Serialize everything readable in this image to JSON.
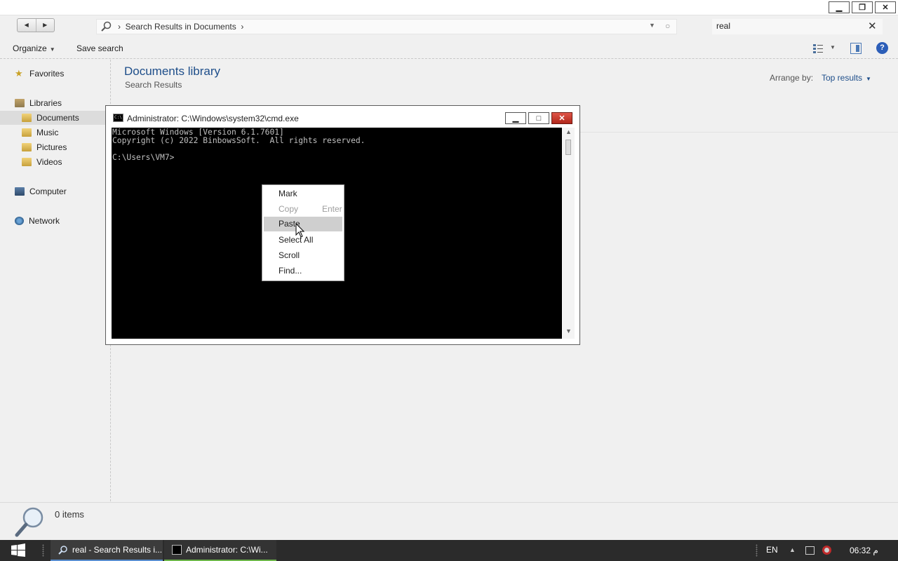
{
  "explorer": {
    "address_path": "Search Results in Documents",
    "address_separator": "›",
    "search_value": "real",
    "organize_label": "Organize",
    "save_search_label": "Save search",
    "library_title": "Documents library",
    "library_subtitle": "Search Results",
    "arrange_label": "Arrange by:",
    "arrange_value": "Top results",
    "status_text": "0 items",
    "nav": {
      "favorites": "Favorites",
      "libraries": "Libraries",
      "documents": "Documents",
      "music": "Music",
      "pictures": "Pictures",
      "videos": "Videos",
      "computer": "Computer",
      "network": "Network"
    }
  },
  "cmd": {
    "title": "Administrator: C:\\Windows\\system32\\cmd.exe",
    "lines": [
      "Microsoft Windows [Version 6.1.7601]",
      "Copyright (c) 2022 BinbowsSoft.  All rights reserved.",
      "",
      "C:\\Users\\VM7>"
    ]
  },
  "context_menu": {
    "items": [
      {
        "label": "Mark",
        "enabled": true,
        "highlighted": false
      },
      {
        "label": "Copy",
        "shortcut": "Enter",
        "enabled": false,
        "highlighted": false
      },
      {
        "label": "Paste",
        "enabled": true,
        "highlighted": true
      },
      {
        "label": "Select All",
        "enabled": true,
        "highlighted": false
      },
      {
        "label": "Scroll",
        "enabled": true,
        "highlighted": false
      },
      {
        "label": "Find...",
        "enabled": true,
        "highlighted": false
      }
    ]
  },
  "taskbar": {
    "explorer_task": "real - Search Results i...",
    "cmd_task": "Administrator: C:\\Wi...",
    "language": "EN",
    "clock": "06:32 م"
  },
  "colors": {
    "accent_blue": "#1e4e8a",
    "taskbar_bg": "#2b2b2b",
    "console_bg": "#000000",
    "console_fg": "#c0c0c0",
    "close_red": "#c83a2c"
  }
}
